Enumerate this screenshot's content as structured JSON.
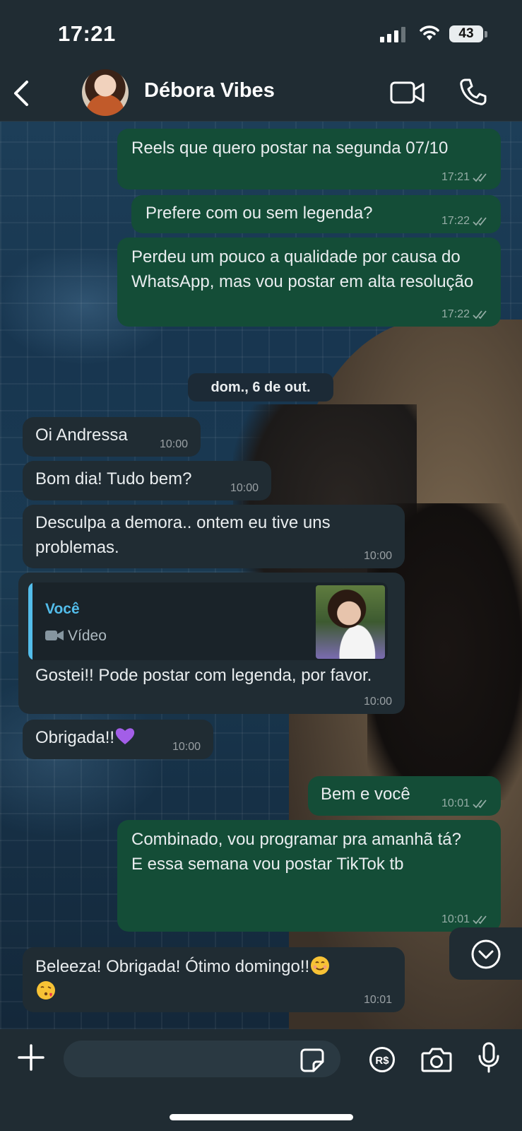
{
  "status_bar": {
    "time": "17:21",
    "battery": "43"
  },
  "header": {
    "contact_name": "Débora Vibes"
  },
  "messages": [
    {
      "id": "m1",
      "direction": "out",
      "text": "Reels que quero postar na segunda 07/10",
      "time": "17:21"
    },
    {
      "id": "m2",
      "direction": "out",
      "text": "Prefere com ou sem legenda?",
      "time": "17:22"
    },
    {
      "id": "m3",
      "direction": "out",
      "text": "Perdeu um pouco a qualidade por causa do WhatsApp, mas vou postar em alta resolução",
      "time": "17:22"
    },
    {
      "id": "m4",
      "direction": "in",
      "text": "Oi Andressa",
      "time": "10:00"
    },
    {
      "id": "m5",
      "direction": "in",
      "text": "Bom dia! Tudo bem?",
      "time": "10:00"
    },
    {
      "id": "m6",
      "direction": "in",
      "text": "Desculpa a demora.. ontem eu tive uns problemas.",
      "time": "10:00"
    },
    {
      "id": "m7",
      "direction": "in",
      "text": "Gostei!! Pode postar com legenda, por favor.",
      "time": "10:00",
      "reply": {
        "author": "Você",
        "kind": "Vídeo"
      }
    },
    {
      "id": "m8",
      "direction": "in",
      "text": "Obrigada!!",
      "time": "10:00"
    },
    {
      "id": "m9",
      "direction": "out",
      "text": "Bem e você",
      "time": "10:01"
    },
    {
      "id": "m10",
      "direction": "out",
      "text_lines": [
        "Combinado, vou programar pra amanhã tá?",
        "E essa semana vou postar TikTok tb"
      ],
      "time": "10:01"
    },
    {
      "id": "m11",
      "direction": "in",
      "text": "Beleeza! Obrigada! Ótimo domingo!!",
      "time": "10:01"
    }
  ],
  "date_separator": "dom., 6 de out.",
  "composer": {
    "placeholder": "",
    "value": ""
  },
  "icons": {
    "back": "chevron-left-icon",
    "video": "video-camera-icon",
    "call": "phone-icon",
    "plus": "plus-icon",
    "sticker": "sticker-icon",
    "payment": "currency-real-icon",
    "camera": "camera-icon",
    "mic": "microphone-icon",
    "scroll": "chevron-down-circle-icon"
  },
  "colors": {
    "outgoing": "#144d37",
    "incoming": "#202c33",
    "header": "#202c33",
    "reply_accent": "#53bdeb"
  }
}
